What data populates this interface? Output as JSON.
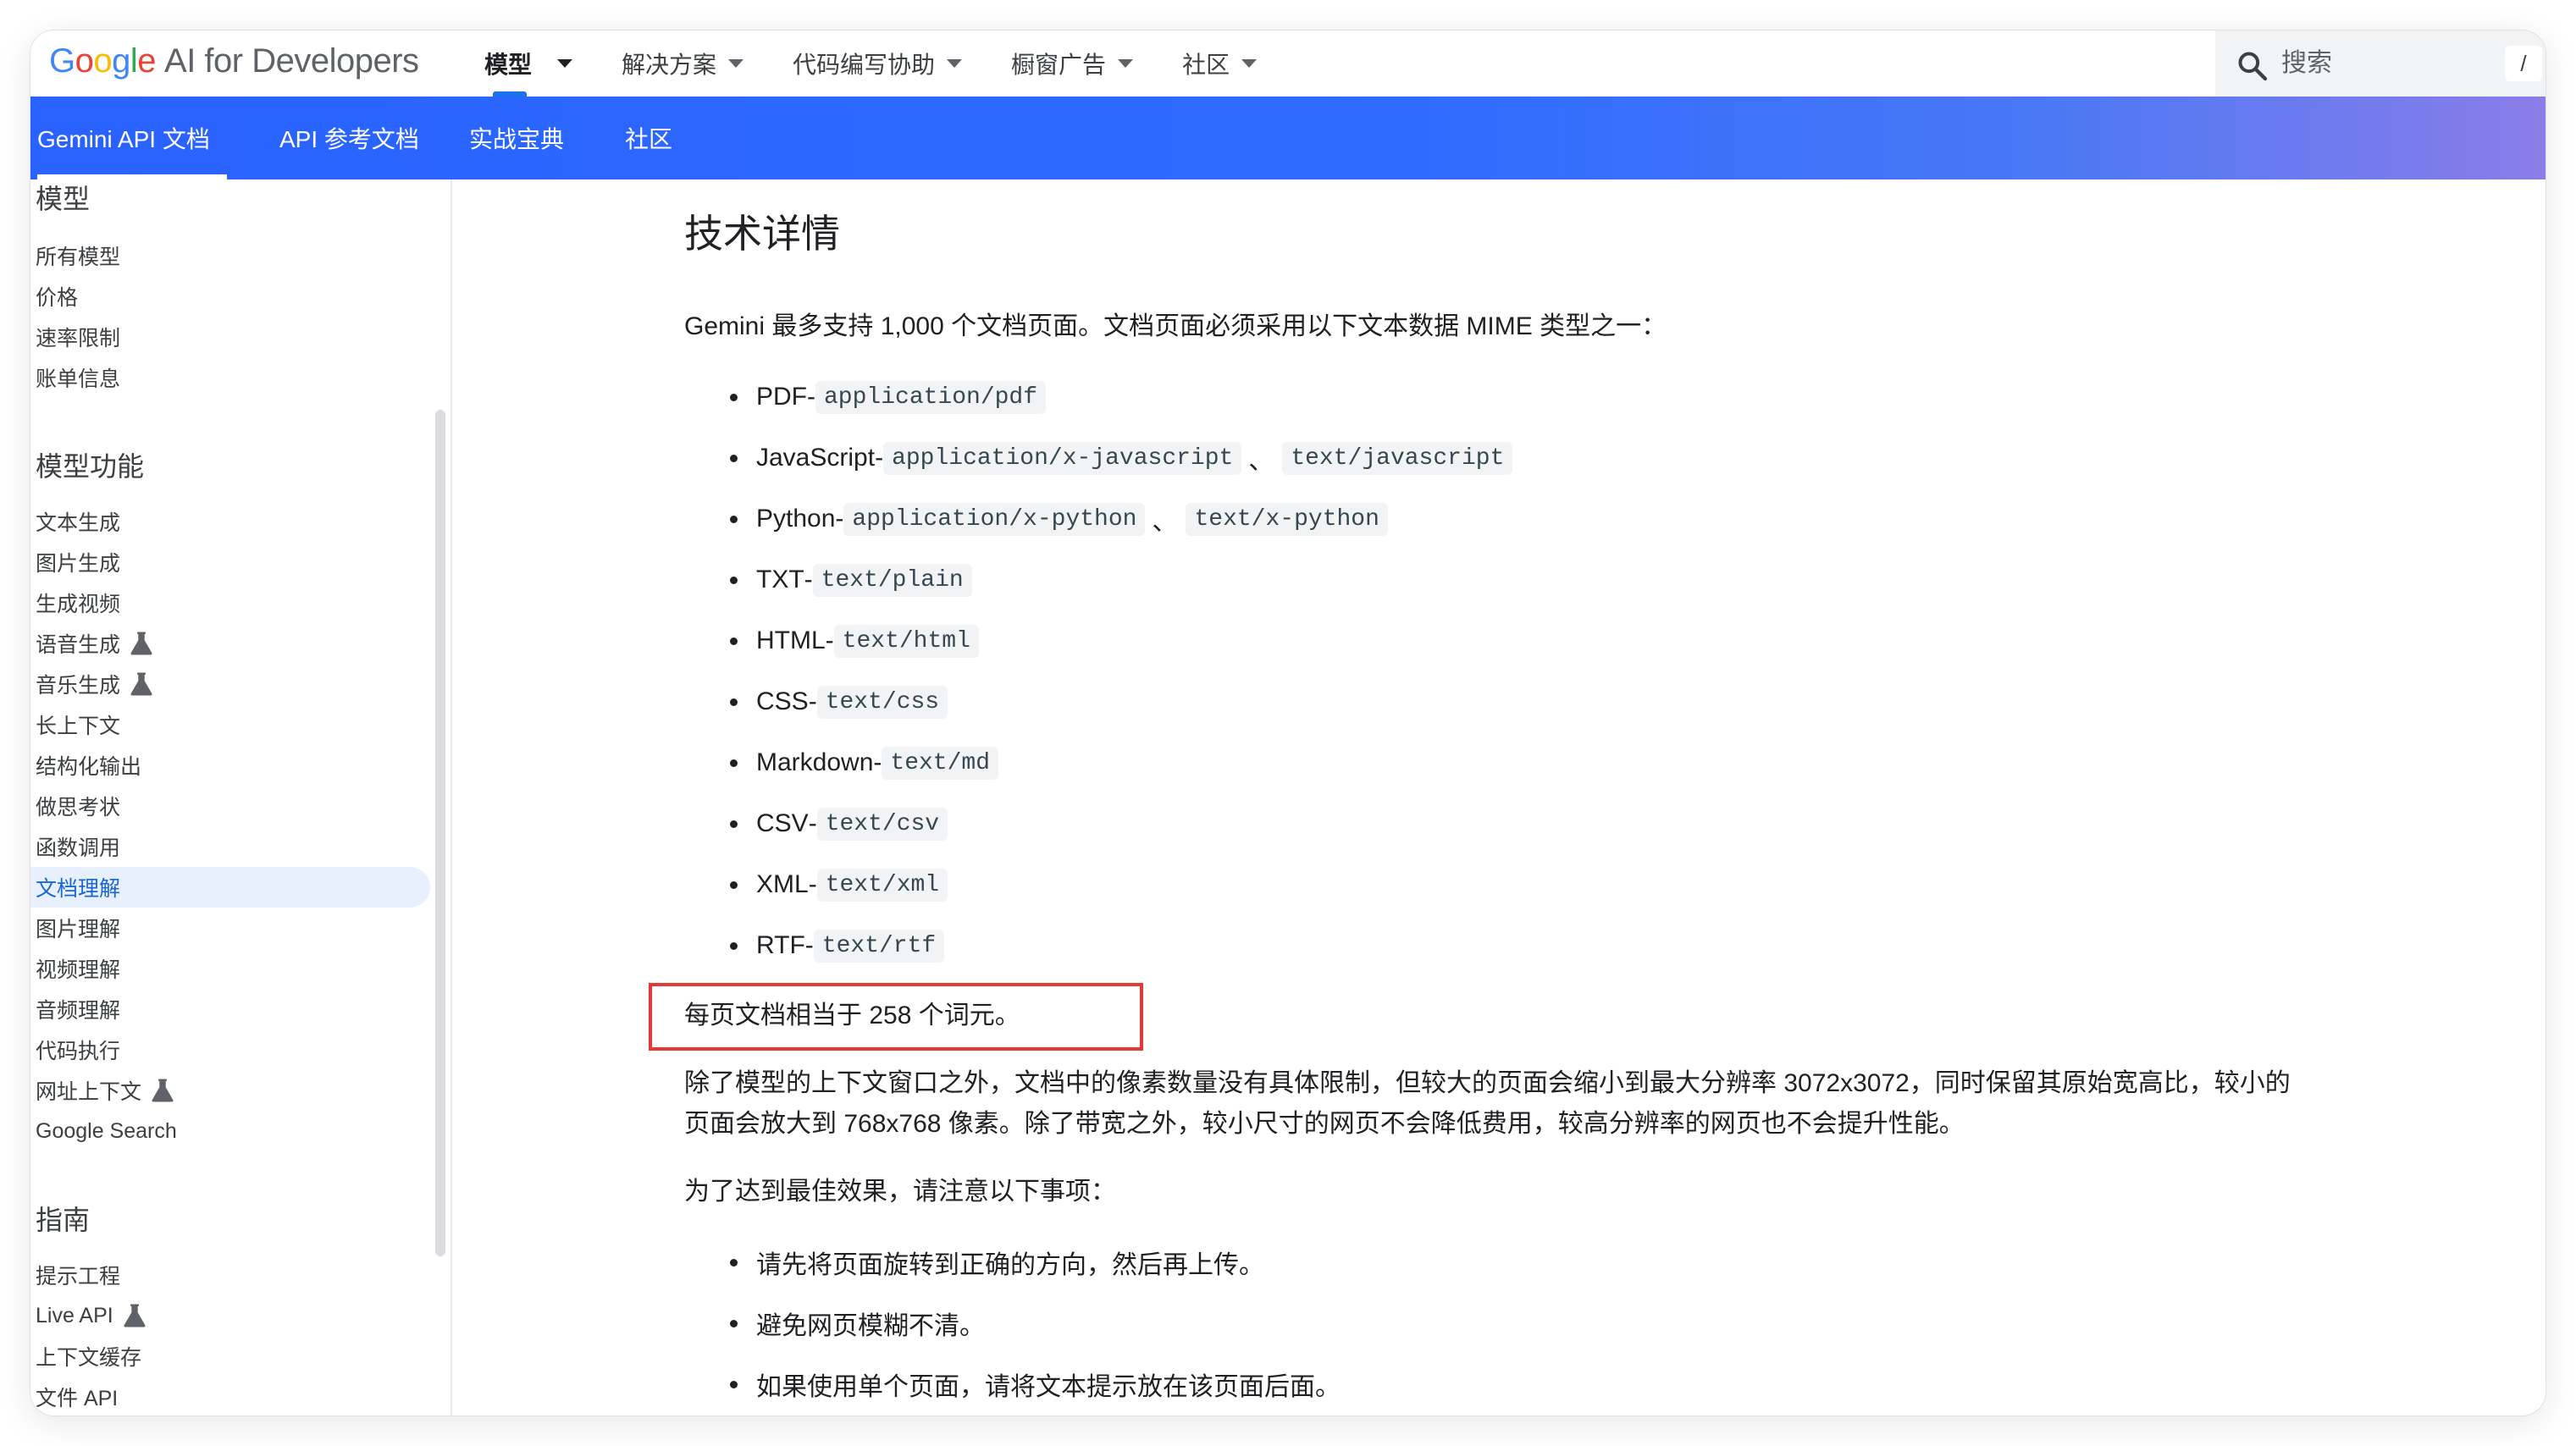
{
  "header": {
    "logo": {
      "google": [
        "G",
        "o",
        "o",
        "g",
        "l",
        "e"
      ],
      "product": "AI for Developers"
    },
    "nav": [
      {
        "label": "模型",
        "active": true
      },
      {
        "label": "解决方案",
        "active": false
      },
      {
        "label": "代码编写协助",
        "active": false
      },
      {
        "label": "橱窗广告",
        "active": false
      },
      {
        "label": "社区",
        "active": false
      }
    ],
    "search": {
      "placeholder": "搜索",
      "shortcut": "/"
    }
  },
  "tabs": [
    {
      "label": "Gemini API 文档",
      "active": true
    },
    {
      "label": "API 参考文档",
      "active": false
    },
    {
      "label": "实战宝典",
      "active": false
    },
    {
      "label": "社区",
      "active": false
    }
  ],
  "sidebar": {
    "sections": [
      {
        "heading": "模型",
        "items": [
          "所有模型",
          "价格",
          "速率限制",
          "账单信息"
        ]
      },
      {
        "heading": "模型功能",
        "items": [
          "文本生成",
          "图片生成",
          "生成视频",
          "语音生成",
          "音乐生成",
          "长上下文",
          "结构化输出",
          "做思考状",
          "函数调用",
          "文档理解",
          "图片理解",
          "视频理解",
          "音频理解",
          "代码执行",
          "网址上下文",
          "Google Search"
        ]
      },
      {
        "heading": "指南",
        "items": [
          "提示工程",
          "Live API",
          "上下文缓存",
          "文件 API"
        ]
      }
    ],
    "experimental": [
      "语音生成",
      "音乐生成",
      "网址上下文",
      "Live API"
    ],
    "active_item": "文档理解"
  },
  "content": {
    "heading": "技术详情",
    "intro": "Gemini 最多支持 1,000 个文档页面。文档页面必须采用以下文本数据 MIME 类型之一：",
    "mime_list": [
      {
        "name": "PDF",
        "types": [
          "application/pdf"
        ]
      },
      {
        "name": "JavaScript",
        "types": [
          "application/x-javascript",
          "text/javascript"
        ]
      },
      {
        "name": "Python",
        "types": [
          "application/x-python",
          "text/x-python"
        ]
      },
      {
        "name": "TXT",
        "types": [
          "text/plain"
        ]
      },
      {
        "name": "HTML",
        "types": [
          "text/html"
        ]
      },
      {
        "name": "CSS",
        "types": [
          "text/css"
        ]
      },
      {
        "name": "Markdown",
        "types": [
          "text/md"
        ]
      },
      {
        "name": "CSV",
        "types": [
          "text/csv"
        ]
      },
      {
        "name": "XML",
        "types": [
          "text/xml"
        ]
      },
      {
        "name": "RTF",
        "types": [
          "text/rtf"
        ]
      }
    ],
    "name_separator": " - ",
    "type_separator": "、",
    "tokens_note": "每页文档相当于 258 个词元。",
    "resolution_note": [
      "除了模型的上下文窗口之外，文档中的像素数量没有具体限制，但较大的页面会缩小到最大分辨率 3072x3072，同时保留其原始宽高比，较小的",
      "页面会放大到 768x768 像素。除了带宽之外，较小尺寸的网页不会降低费用，较高分辨率的网页也不会提升性能。"
    ],
    "tips_intro": "为了达到最佳效果，请注意以下事项：",
    "tips": [
      "请先将页面旋转到正确的方向，然后再上传。",
      "避免网页模糊不清。",
      "如果使用单个页面，请将文本提示放在该页面后面。"
    ]
  },
  "colors": {
    "accent": "#1a73e8",
    "tabbar_start": "#2962ff",
    "tabbar_end": "#8a7de8",
    "highlight_box": "#e53935",
    "active_nav_bg": "#e8f0fe"
  }
}
